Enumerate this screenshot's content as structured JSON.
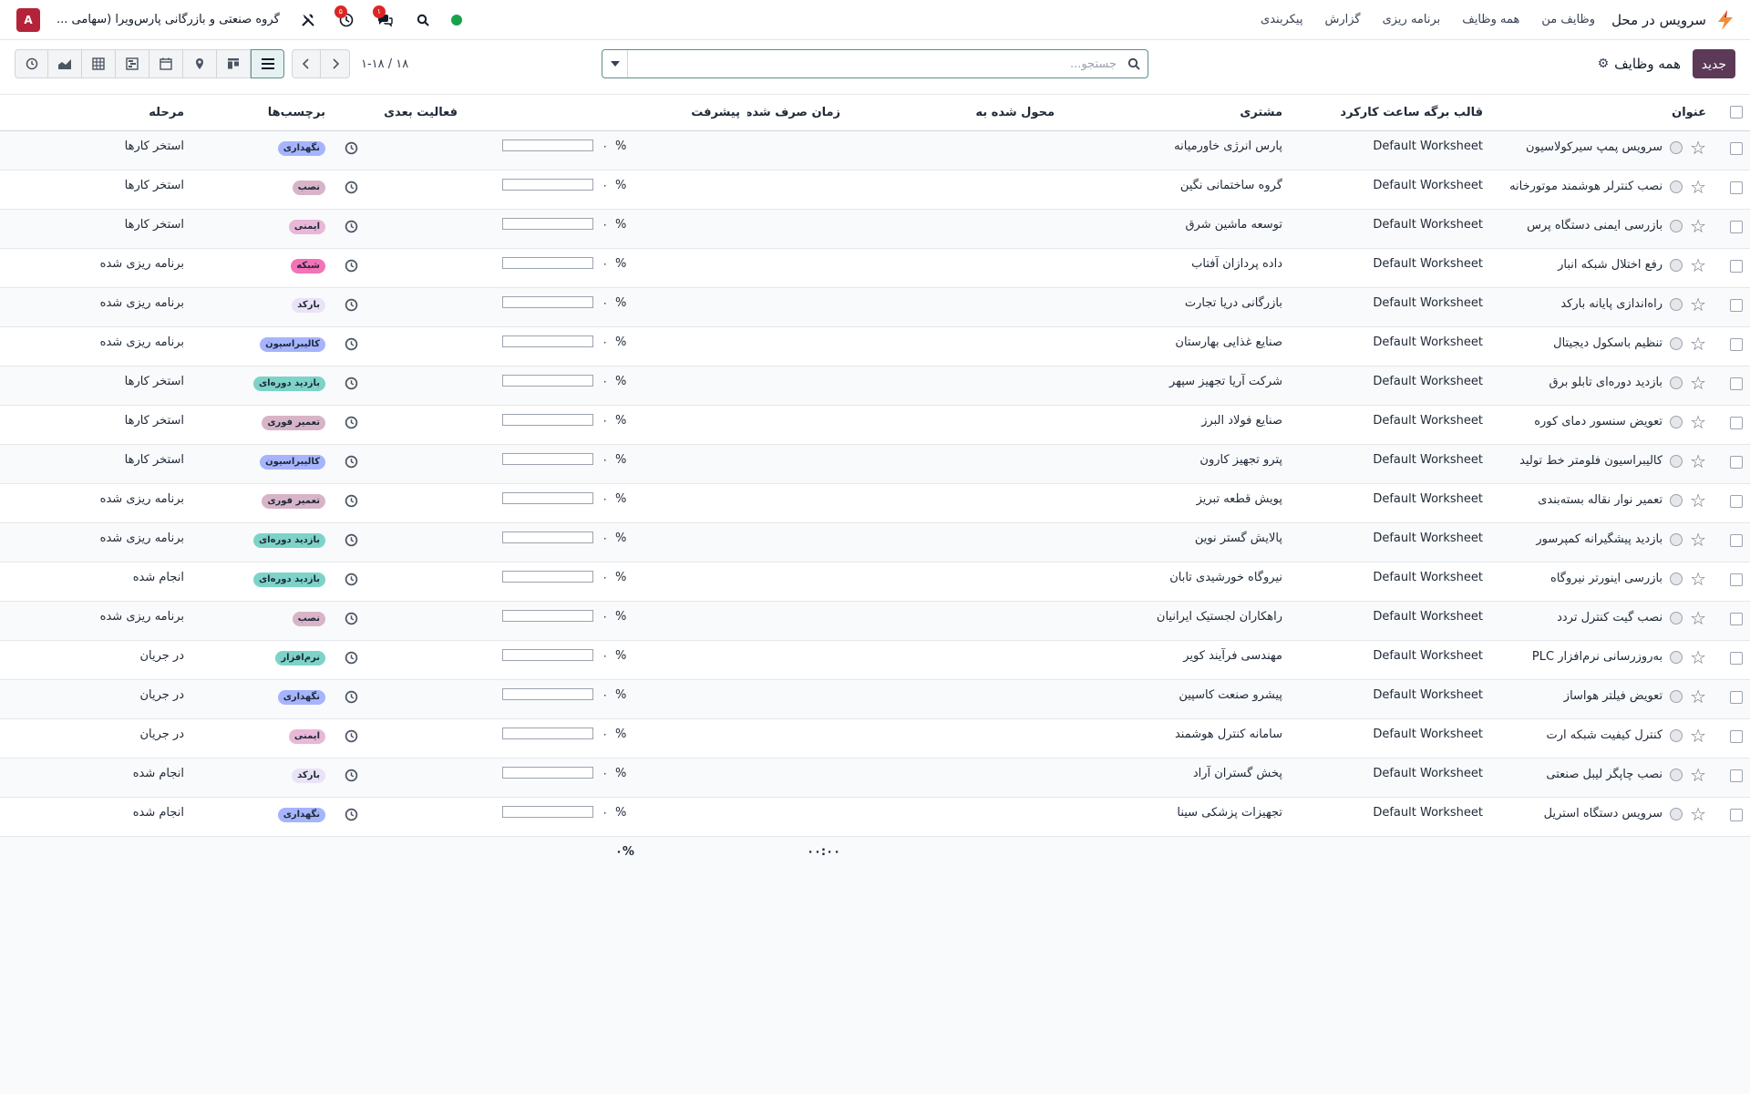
{
  "navbar": {
    "app_name": "سرویس در محل",
    "menu": [
      "وظایف من",
      "همه وظایف",
      "برنامه ریزی",
      "گزارش",
      "پیکربندی"
    ],
    "company_name": "گروه صنعتی و بازرگانی پارس‌ویرا (سهامی ...",
    "activity_badge": "۵",
    "messages_badge": "۱",
    "avatar_letter": "A"
  },
  "control_panel": {
    "new_button": "جدید",
    "breadcrumb": "همه وظایف",
    "search_placeholder": "جستجو...",
    "pager_value": "۱-۱۸ / ۱۸"
  },
  "columns": {
    "title": "عنوان",
    "worksheet": "قالب برگه ساعت کارکرد",
    "customer": "مشتری",
    "assigned": "محول شده به",
    "time_spent": "زمان صرف شده",
    "progress": "پیشرفت",
    "activity": "فعالیت بعدی",
    "tags": "برچسب‌ها",
    "stage": "مرحله"
  },
  "rows": [
    {
      "title": "سرویس پمپ سیرکولاسیون",
      "worksheet": "Default Worksheet",
      "customer": "پارس انرژی خاورمیانه",
      "pct": "%",
      "progress_text": "۰",
      "progress_value": 0,
      "tag": "نگهداری",
      "tag_color": "#a5b4fc",
      "stage": "استخر کارها"
    },
    {
      "title": "نصب کنترلر هوشمند موتورخانه",
      "worksheet": "Default Worksheet",
      "customer": "گروه ساختمانی نگین",
      "pct": "%",
      "progress_text": "۰",
      "progress_value": 0,
      "tag": "نصب",
      "tag_color": "#d8b4c8",
      "stage": "استخر کارها"
    },
    {
      "title": "بازرسی ایمنی دستگاه پرس",
      "worksheet": "Default Worksheet",
      "customer": "توسعه ماشین شرق",
      "pct": "%",
      "progress_text": "۰",
      "progress_value": 0,
      "tag": "ایمنی",
      "tag_color": "#e9b8d8",
      "stage": "استخر کارها"
    },
    {
      "title": "رفع اختلال شبکه انبار",
      "worksheet": "Default Worksheet",
      "customer": "داده پردازان آفتاب",
      "pct": "%",
      "progress_text": "۰",
      "progress_value": 0,
      "tag": "شبکه",
      "tag_color": "#f472b6",
      "stage": "برنامه ریزی شده"
    },
    {
      "title": "راه‌اندازی پایانه بارکد",
      "worksheet": "Default Worksheet",
      "customer": "بازرگانی دریا تجارت",
      "pct": "%",
      "progress_text": "۰",
      "progress_value": 0,
      "tag": "بارکد",
      "tag_color": "#e9e3f5",
      "stage": "برنامه ریزی شده"
    },
    {
      "title": "تنظیم باسکول دیجیتال",
      "worksheet": "Default Worksheet",
      "customer": "صنایع غذایی بهارستان",
      "pct": "%",
      "progress_text": "۰",
      "progress_value": 0,
      "tag": "کالیبراسیون",
      "tag_color": "#a5b4fc",
      "stage": "برنامه ریزی شده"
    },
    {
      "title": "بازدید دوره‌ای تابلو برق",
      "worksheet": "Default Worksheet",
      "customer": "شرکت آریا تجهیز سپهر",
      "pct": "%",
      "progress_text": "۰",
      "progress_value": 0,
      "tag": "بازدید دوره‌ای",
      "tag_color": "#7dd3c8",
      "stage": "استخر کارها"
    },
    {
      "title": "تعویض سنسور دمای کوره",
      "worksheet": "Default Worksheet",
      "customer": "صنایع فولاد البرز",
      "pct": "%",
      "progress_text": "۰",
      "progress_value": 0,
      "tag": "تعمیر فوری",
      "tag_color": "#d8b4c8",
      "stage": "استخر کارها"
    },
    {
      "title": "کالیبراسیون فلومتر خط تولید",
      "worksheet": "Default Worksheet",
      "customer": "پترو تجهیز کارون",
      "pct": "%",
      "progress_text": "۰",
      "progress_value": 0,
      "tag": "کالیبراسیون",
      "tag_color": "#a5b4fc",
      "stage": "استخر کارها"
    },
    {
      "title": "تعمیر نوار نقاله بسته‌بندی",
      "worksheet": "Default Worksheet",
      "customer": "پویش قطعه تبریز",
      "pct": "%",
      "progress_text": "۰",
      "progress_value": 0,
      "tag": "تعمیر فوری",
      "tag_color": "#d8b4c8",
      "stage": "برنامه ریزی شده"
    },
    {
      "title": "بازدید پیشگیرانه کمپرسور",
      "worksheet": "Default Worksheet",
      "customer": "پالایش گستر نوین",
      "pct": "%",
      "progress_text": "۰",
      "progress_value": 0,
      "tag": "بازدید دوره‌ای",
      "tag_color": "#7dd3c8",
      "stage": "برنامه ریزی شده"
    },
    {
      "title": "بازرسی اینورتر نیروگاه",
      "worksheet": "Default Worksheet",
      "customer": "نیروگاه خورشیدی تابان",
      "pct": "%",
      "progress_text": "۰",
      "progress_value": 0,
      "tag": "بازدید دوره‌ای",
      "tag_color": "#7dd3c8",
      "stage": "انجام شده"
    },
    {
      "title": "نصب گیت کنترل تردد",
      "worksheet": "Default Worksheet",
      "customer": "راهکاران لجستیک ایرانیان",
      "pct": "%",
      "progress_text": "۰",
      "progress_value": 0,
      "tag": "نصب",
      "tag_color": "#d8b4c8",
      "stage": "برنامه ریزی شده"
    },
    {
      "title": "به‌روزرسانی نرم‌افزار PLC",
      "worksheet": "Default Worksheet",
      "customer": "مهندسی فرآیند کویر",
      "pct": "%",
      "progress_text": "۰",
      "progress_value": 0,
      "tag": "نرم‌افزار",
      "tag_color": "#7dd3c8",
      "stage": "در جریان"
    },
    {
      "title": "تعویض فیلتر هواساز",
      "worksheet": "Default Worksheet",
      "customer": "پیشرو صنعت کاسپین",
      "pct": "%",
      "progress_text": "۰",
      "progress_value": 0,
      "tag": "نگهداری",
      "tag_color": "#a5b4fc",
      "stage": "در جریان"
    },
    {
      "title": "کنترل کیفیت شبکه ارت",
      "worksheet": "Default Worksheet",
      "customer": "سامانه کنترل هوشمند",
      "pct": "%",
      "progress_text": "۰",
      "progress_value": 0,
      "tag": "ایمنی",
      "tag_color": "#e9b8d8",
      "stage": "در جریان"
    },
    {
      "title": "نصب چاپگر لیبل صنعتی",
      "worksheet": "Default Worksheet",
      "customer": "پخش گستران آراد",
      "pct": "%",
      "progress_text": "۰",
      "progress_value": 0,
      "tag": "بارکد",
      "tag_color": "#e9e3f5",
      "stage": "انجام شده"
    },
    {
      "title": "سرویس دستگاه استریل",
      "worksheet": "Default Worksheet",
      "customer": "تجهیزات پزشکی سینا",
      "pct": "%",
      "progress_text": "۰",
      "progress_value": 0,
      "tag": "نگهداری",
      "tag_color": "#a5b4fc",
      "stage": "انجام شده"
    }
  ],
  "footer": {
    "time_total": "۰۰:۰۰",
    "progress_total": "۰%"
  },
  "colors": {
    "brand": "#5c3a57",
    "accent": "#5c8f8a",
    "online": "#16a34a",
    "badge": "#dc2626",
    "avatar": "#b4233a"
  }
}
